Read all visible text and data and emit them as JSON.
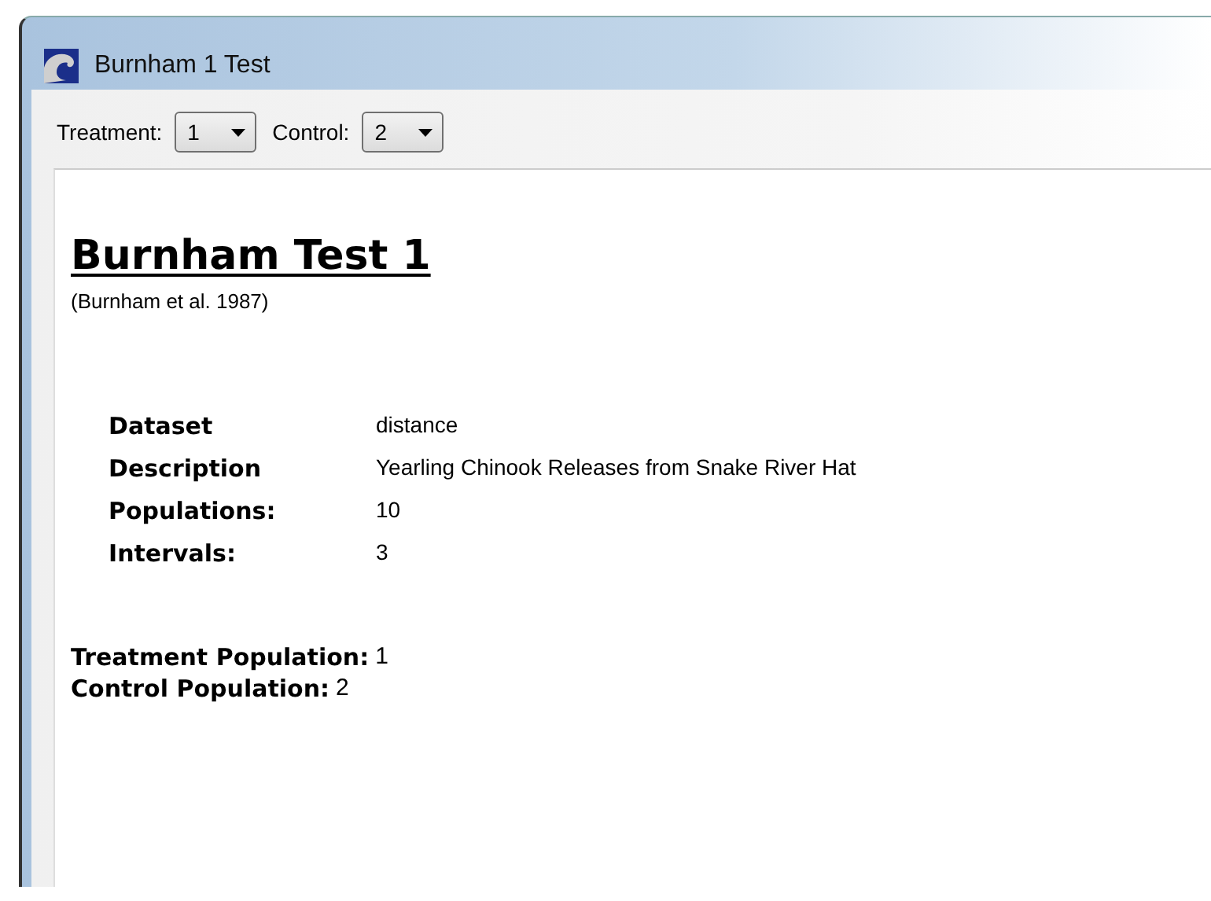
{
  "window": {
    "title": "Burnham 1 Test"
  },
  "toolbar": [
    {
      "label": "Treatment:",
      "value": "1"
    },
    {
      "label": "Control:",
      "value": "2"
    }
  ],
  "report": {
    "heading": "Burnham Test 1",
    "citation": "(Burnham et al. 1987)",
    "details": [
      {
        "label": "Dataset",
        "value": "distance"
      },
      {
        "label": "Description",
        "value": "Yearling Chinook Releases from Snake River Hat"
      },
      {
        "label": "Populations:",
        "value": "10"
      },
      {
        "label": "Intervals:",
        "value": "3"
      }
    ],
    "summary": [
      {
        "label": "Treatment Population:",
        "value": "1"
      },
      {
        "label": "Control Population:",
        "value": "2"
      }
    ]
  }
}
